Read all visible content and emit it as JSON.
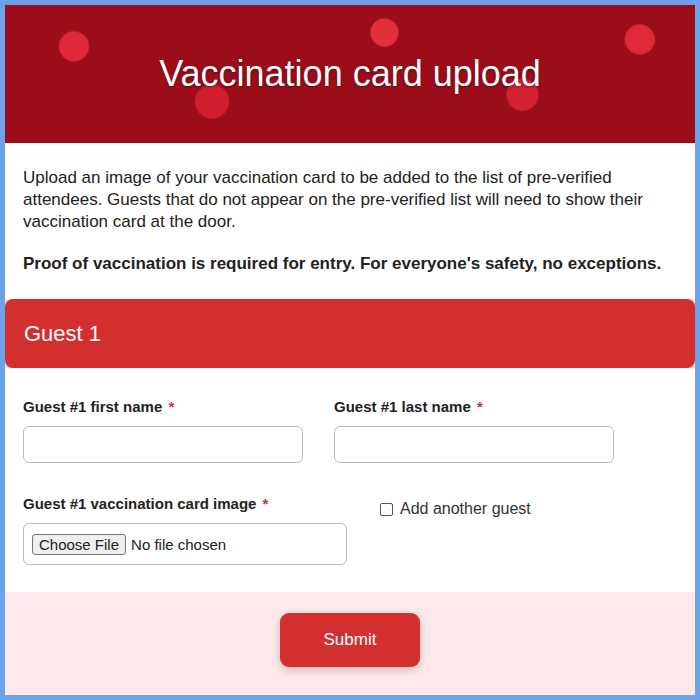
{
  "header": {
    "title": "Vaccination card upload"
  },
  "intro": {
    "text": "Upload an image of your vaccination card to be added to the list of pre-verified attendees. Guests that do not appear on the pre-verified list will need to show their vaccination card at the door.",
    "notice": "Proof of vaccination is required for entry. For everyone's safety, no exceptions."
  },
  "section": {
    "title": "Guest 1"
  },
  "fields": [
    {
      "label": "Guest #1 first name",
      "required": true,
      "required_mark": "*",
      "value": ""
    },
    {
      "label": "Guest #1 last name",
      "required": true,
      "required_mark": "*",
      "value": ""
    }
  ],
  "file_field": {
    "label": "Guest #1 vaccination card image",
    "required": true,
    "required_mark": "*",
    "button": "Choose File",
    "status": "No file chosen"
  },
  "add_guest": {
    "label": "Add another guest",
    "checked": false
  },
  "submit": {
    "label": "Submit"
  }
}
